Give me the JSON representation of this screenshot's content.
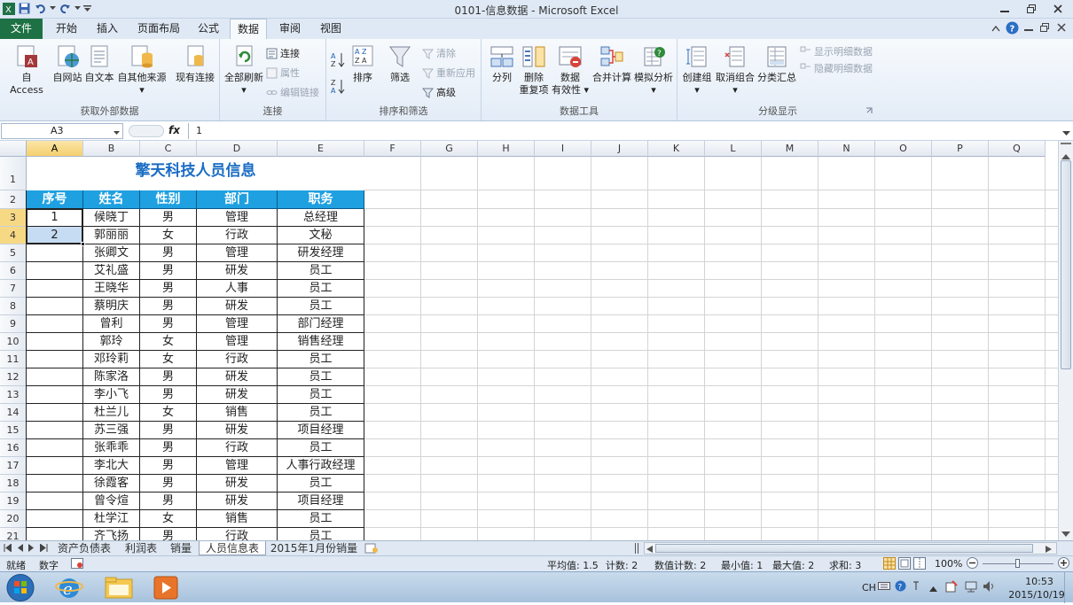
{
  "window": {
    "title": "0101-信息数据 - Microsoft Excel"
  },
  "ribbon_tabs": [
    "文件",
    "开始",
    "插入",
    "页面布局",
    "公式",
    "数据",
    "审阅",
    "视图"
  ],
  "active_tab": "数据",
  "groups": {
    "external": {
      "label": "获取外部数据",
      "buttons": [
        "自 Access",
        "自网站",
        "自文本",
        "自其他来源",
        "现有连接"
      ]
    },
    "connections": {
      "label": "连接",
      "refresh": "全部刷新",
      "small": [
        "连接",
        "属性",
        "编辑链接"
      ]
    },
    "sortfilter": {
      "label": "排序和筛选",
      "sort": "排序",
      "filter": "筛选",
      "small": [
        "清除",
        "重新应用",
        "高级"
      ]
    },
    "datatools": {
      "label": "数据工具",
      "split": "分列",
      "dup1": "删除",
      "dup2": "重复项",
      "val1": "数据",
      "val2": "有效性",
      "consolidate": "合并计算",
      "whatif": "模拟分析"
    },
    "outline": {
      "label": "分级显示",
      "group": "创建组",
      "ungroup": "取消组合",
      "subtotal": "分类汇总",
      "small": [
        "显示明细数据",
        "隐藏明细数据"
      ]
    }
  },
  "formula_bar": {
    "name_box": "A3",
    "fx": "fx",
    "value": "1"
  },
  "columns": [
    "A",
    "B",
    "C",
    "D",
    "E",
    "F",
    "G",
    "H",
    "I",
    "J",
    "K",
    "L",
    "M",
    "N",
    "O",
    "P",
    "Q"
  ],
  "row_numbers": [
    "1",
    "2",
    "3",
    "4",
    "5",
    "6",
    "7",
    "8",
    "9",
    "10",
    "11",
    "12",
    "13",
    "14",
    "15",
    "16",
    "17",
    "18",
    "19",
    "20",
    "21"
  ],
  "sheet": {
    "title": "擎天科技人员信息",
    "headers": [
      "序号",
      "姓名",
      "性别",
      "部门",
      "职务"
    ],
    "rows": [
      [
        "1",
        "候晓丁",
        "男",
        "管理",
        "总经理"
      ],
      [
        "2",
        "郭丽丽",
        "女",
        "行政",
        "文秘"
      ],
      [
        "",
        "张卿文",
        "男",
        "管理",
        "研发经理"
      ],
      [
        "",
        "艾礼盛",
        "男",
        "研发",
        "员工"
      ],
      [
        "",
        "王晓华",
        "男",
        "人事",
        "员工"
      ],
      [
        "",
        "蔡明庆",
        "男",
        "研发",
        "员工"
      ],
      [
        "",
        "曾利",
        "男",
        "管理",
        "部门经理"
      ],
      [
        "",
        "郭玲",
        "女",
        "管理",
        "销售经理"
      ],
      [
        "",
        "邓玲莉",
        "女",
        "行政",
        "员工"
      ],
      [
        "",
        "陈家洛",
        "男",
        "研发",
        "员工"
      ],
      [
        "",
        "李小飞",
        "男",
        "研发",
        "员工"
      ],
      [
        "",
        "杜兰儿",
        "女",
        "销售",
        "员工"
      ],
      [
        "",
        "苏三强",
        "男",
        "研发",
        "项目经理"
      ],
      [
        "",
        "张乖乖",
        "男",
        "行政",
        "员工"
      ],
      [
        "",
        "李北大",
        "男",
        "管理",
        "人事行政经理"
      ],
      [
        "",
        "徐霞客",
        "男",
        "研发",
        "员工"
      ],
      [
        "",
        "曾令煊",
        "男",
        "研发",
        "项目经理"
      ],
      [
        "",
        "杜学江",
        "女",
        "销售",
        "员工"
      ],
      [
        "",
        "齐飞扬",
        "男",
        "行政",
        "员工"
      ]
    ]
  },
  "sheet_tabs": [
    "资产负债表",
    "利润表",
    "销量",
    "人员信息表",
    "2015年1月份销量"
  ],
  "active_sheet": "人员信息表",
  "status": {
    "ready": "就绪",
    "mode": "数字",
    "average": "平均值: 1.5",
    "count": "计数: 2",
    "numcount": "数值计数: 2",
    "min": "最小值: 1",
    "max": "最大值: 2",
    "sum": "求和: 3",
    "zoom": "100%"
  },
  "taskbar": {
    "lang": "CH",
    "time": "10:53",
    "date": "2015/10/19"
  },
  "colors": {
    "header_fill": "#1fa0e0",
    "title_color": "#1a6cc4",
    "excel_green": "#1e7145",
    "selection": "#c6dcf2"
  }
}
